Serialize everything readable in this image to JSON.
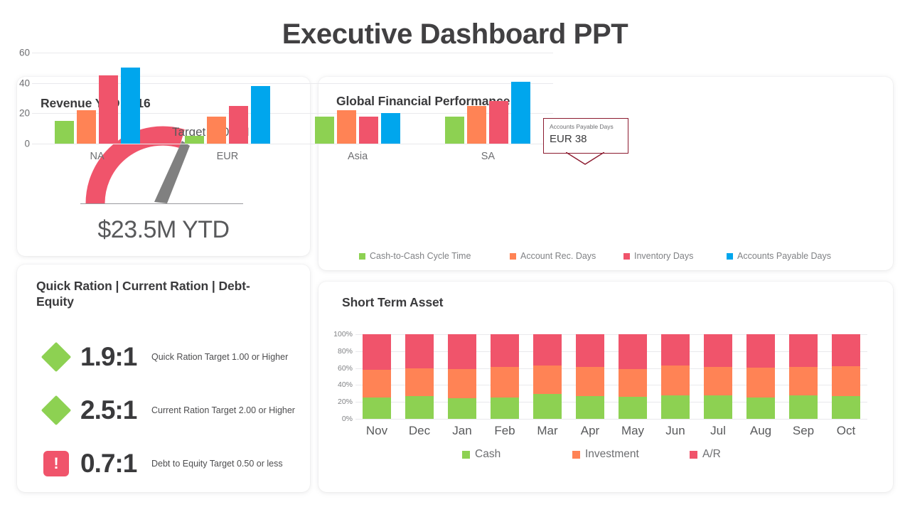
{
  "page": {
    "title": "Executive Dashboard PPT",
    "title_color": "#414042",
    "background": "#ffffff"
  },
  "palette": {
    "green": "#8DD152",
    "orange": "#FF8355",
    "red": "#F0546B",
    "blue": "#00A6ED",
    "needle_gray": "#808080",
    "callout_border": "#8C1B2F"
  },
  "revenue_card": {
    "title": "Revenue YTD 2016",
    "target_label": "Target $30.0M",
    "value_label": "$23.5M YTD",
    "gauge": {
      "arc_color": "#F0546B",
      "needle_color": "#808080",
      "target_value": 30.0,
      "current_value": 23.5,
      "units": "M"
    }
  },
  "ratios_card": {
    "title": "Quick Ration | Current Ration | Debt-Equity",
    "rows": [
      {
        "icon": "diamond-icon",
        "status": "ok",
        "value": "1.9:1",
        "description": "Quick Ration Target 1.00 or Higher"
      },
      {
        "icon": "diamond-icon",
        "status": "ok",
        "value": "2.5:1",
        "description": "Current  Ration Target 2.00 or Higher"
      },
      {
        "icon": "alert-icon",
        "status": "alert",
        "value": "0.7:1",
        "description": "Debt to Equity Target 0.50 or less"
      }
    ],
    "alert_glyph": "!"
  },
  "global_card": {
    "title": "Global Financial Performance",
    "callout": {
      "label": "Accounts Payable Days",
      "value": "EUR 38"
    }
  },
  "short_term_card": {
    "title": "Short Term Asset"
  },
  "chart_data": [
    {
      "id": "global-financial-performance",
      "type": "bar",
      "title": "Global Financial Performance",
      "xlabel": "",
      "ylabel": "",
      "ylim": [
        0,
        60
      ],
      "yticks": [
        0,
        20,
        40,
        60
      ],
      "ytick_labels": [
        "0",
        "20",
        "40",
        "60"
      ],
      "grid": true,
      "legend_position": "bottom",
      "categories": [
        "NA",
        "EUR",
        "Asia",
        "SA"
      ],
      "series": [
        {
          "name": "Cash-to-Cash Cycle Time",
          "color": "#8DD152",
          "values": [
            15,
            5,
            18,
            18
          ]
        },
        {
          "name": "Account Rec. Days",
          "color": "#FF8355",
          "values": [
            22,
            18,
            22,
            25
          ]
        },
        {
          "name": "Inventory Days",
          "color": "#F0546B",
          "values": [
            45,
            25,
            18,
            28
          ]
        },
        {
          "name": "Accounts Payable Days",
          "color": "#00A6ED",
          "values": [
            50,
            38,
            20,
            41
          ]
        }
      ],
      "annotations": [
        {
          "text": "Accounts Payable Days",
          "value": "EUR 38",
          "category": "EUR",
          "series": "Accounts Payable Days"
        }
      ]
    },
    {
      "id": "short-term-asset",
      "type": "bar",
      "stacked": true,
      "title": "Short Term Asset",
      "xlabel": "",
      "ylabel": "",
      "ylim": [
        0,
        100
      ],
      "yticks": [
        0,
        20,
        40,
        60,
        80,
        100
      ],
      "ytick_labels": [
        "0%",
        "20%",
        "40%",
        "60%",
        "80%",
        "100%"
      ],
      "grid": true,
      "legend_position": "bottom",
      "categories": [
        "Nov",
        "Dec",
        "Jan",
        "Feb",
        "Mar",
        "Apr",
        "May",
        "Jun",
        "Jul",
        "Aug",
        "Sep",
        "Oct"
      ],
      "series": [
        {
          "name": "Cash",
          "color": "#8DD152",
          "values": [
            25,
            27,
            24.5,
            25,
            29,
            26.5,
            26,
            28,
            28,
            25.5,
            27.5,
            27
          ]
        },
        {
          "name": "Investment",
          "color": "#FF8355",
          "values": [
            33,
            33,
            34.5,
            36.5,
            34,
            35,
            33,
            35,
            33,
            35,
            34,
            35
          ]
        },
        {
          "name": "A/R",
          "color": "#F0546B",
          "values": [
            42,
            40,
            41,
            38.5,
            37,
            38.5,
            41,
            37,
            39,
            39.5,
            38.5,
            38
          ]
        }
      ]
    }
  ]
}
